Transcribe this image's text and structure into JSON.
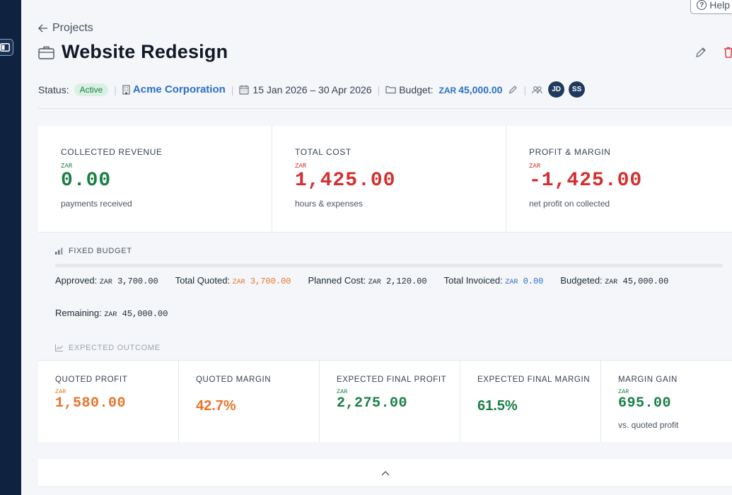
{
  "help": {
    "label": "Help"
  },
  "breadcrumb": {
    "label": "Projects"
  },
  "project": {
    "title": "Website Redesign"
  },
  "meta": {
    "status_label": "Status:",
    "status_value": "Active",
    "client": "Acme Corporation",
    "date_range": "15 Jan 2026 – 30 Apr 2026",
    "budget_label": "Budget:",
    "budget_currency": "ZAR",
    "budget_amount": "45,000.00",
    "team": [
      "JD",
      "SS"
    ]
  },
  "kpis": [
    {
      "label": "COLLECTED REVENUE",
      "currency": "ZAR",
      "value": "0.00",
      "sub": "payments received",
      "color": "#1a7f46"
    },
    {
      "label": "TOTAL COST",
      "currency": "ZAR",
      "value": "1,425.00",
      "sub": "hours & expenses",
      "color": "#d32f2f"
    },
    {
      "label": "PROFIT & MARGIN",
      "currency": "ZAR",
      "value": "-1,425.00",
      "sub": "net profit on collected",
      "color": "#d32f2f"
    }
  ],
  "fixed_budget": {
    "header": "FIXED BUDGET",
    "approved_label": "Approved:",
    "approved_cur": "ZAR",
    "approved_val": "3,700.00",
    "quoted_label": "Total Quoted:",
    "quoted_cur": "ZAR",
    "quoted_val": "3,700.00",
    "planned_label": "Planned Cost:",
    "planned_cur": "ZAR",
    "planned_val": "2,120.00",
    "invoiced_label": "Total Invoiced:",
    "invoiced_cur": "ZAR",
    "invoiced_val": "0.00",
    "budgeted_label": "Budgeted:",
    "budgeted_cur": "ZAR",
    "budgeted_val": "45,000.00",
    "remaining_label": "Remaining:",
    "remaining_cur": "ZAR",
    "remaining_val": "45,000.00"
  },
  "expected_outcome": {
    "header": "EXPECTED OUTCOME",
    "cards": [
      {
        "label": "QUOTED PROFIT",
        "currency": "ZAR",
        "value": "1,580.00",
        "sub": ""
      },
      {
        "label": "QUOTED MARGIN",
        "value": "42.7%"
      },
      {
        "label": "EXPECTED FINAL PROFIT",
        "currency": "ZAR",
        "value": "2,275.00"
      },
      {
        "label": "EXPECTED FINAL MARGIN",
        "value": "61.5%"
      },
      {
        "label": "MARGIN GAIN",
        "currency": "ZAR",
        "value": "695.00",
        "sub": "vs. quoted profit"
      }
    ]
  },
  "colors": {
    "accent": "#2a6fc9",
    "positive": "#1a7f46",
    "negative": "#d32f2f",
    "warning": "#e8742a",
    "sidebar": "#0f2240"
  }
}
